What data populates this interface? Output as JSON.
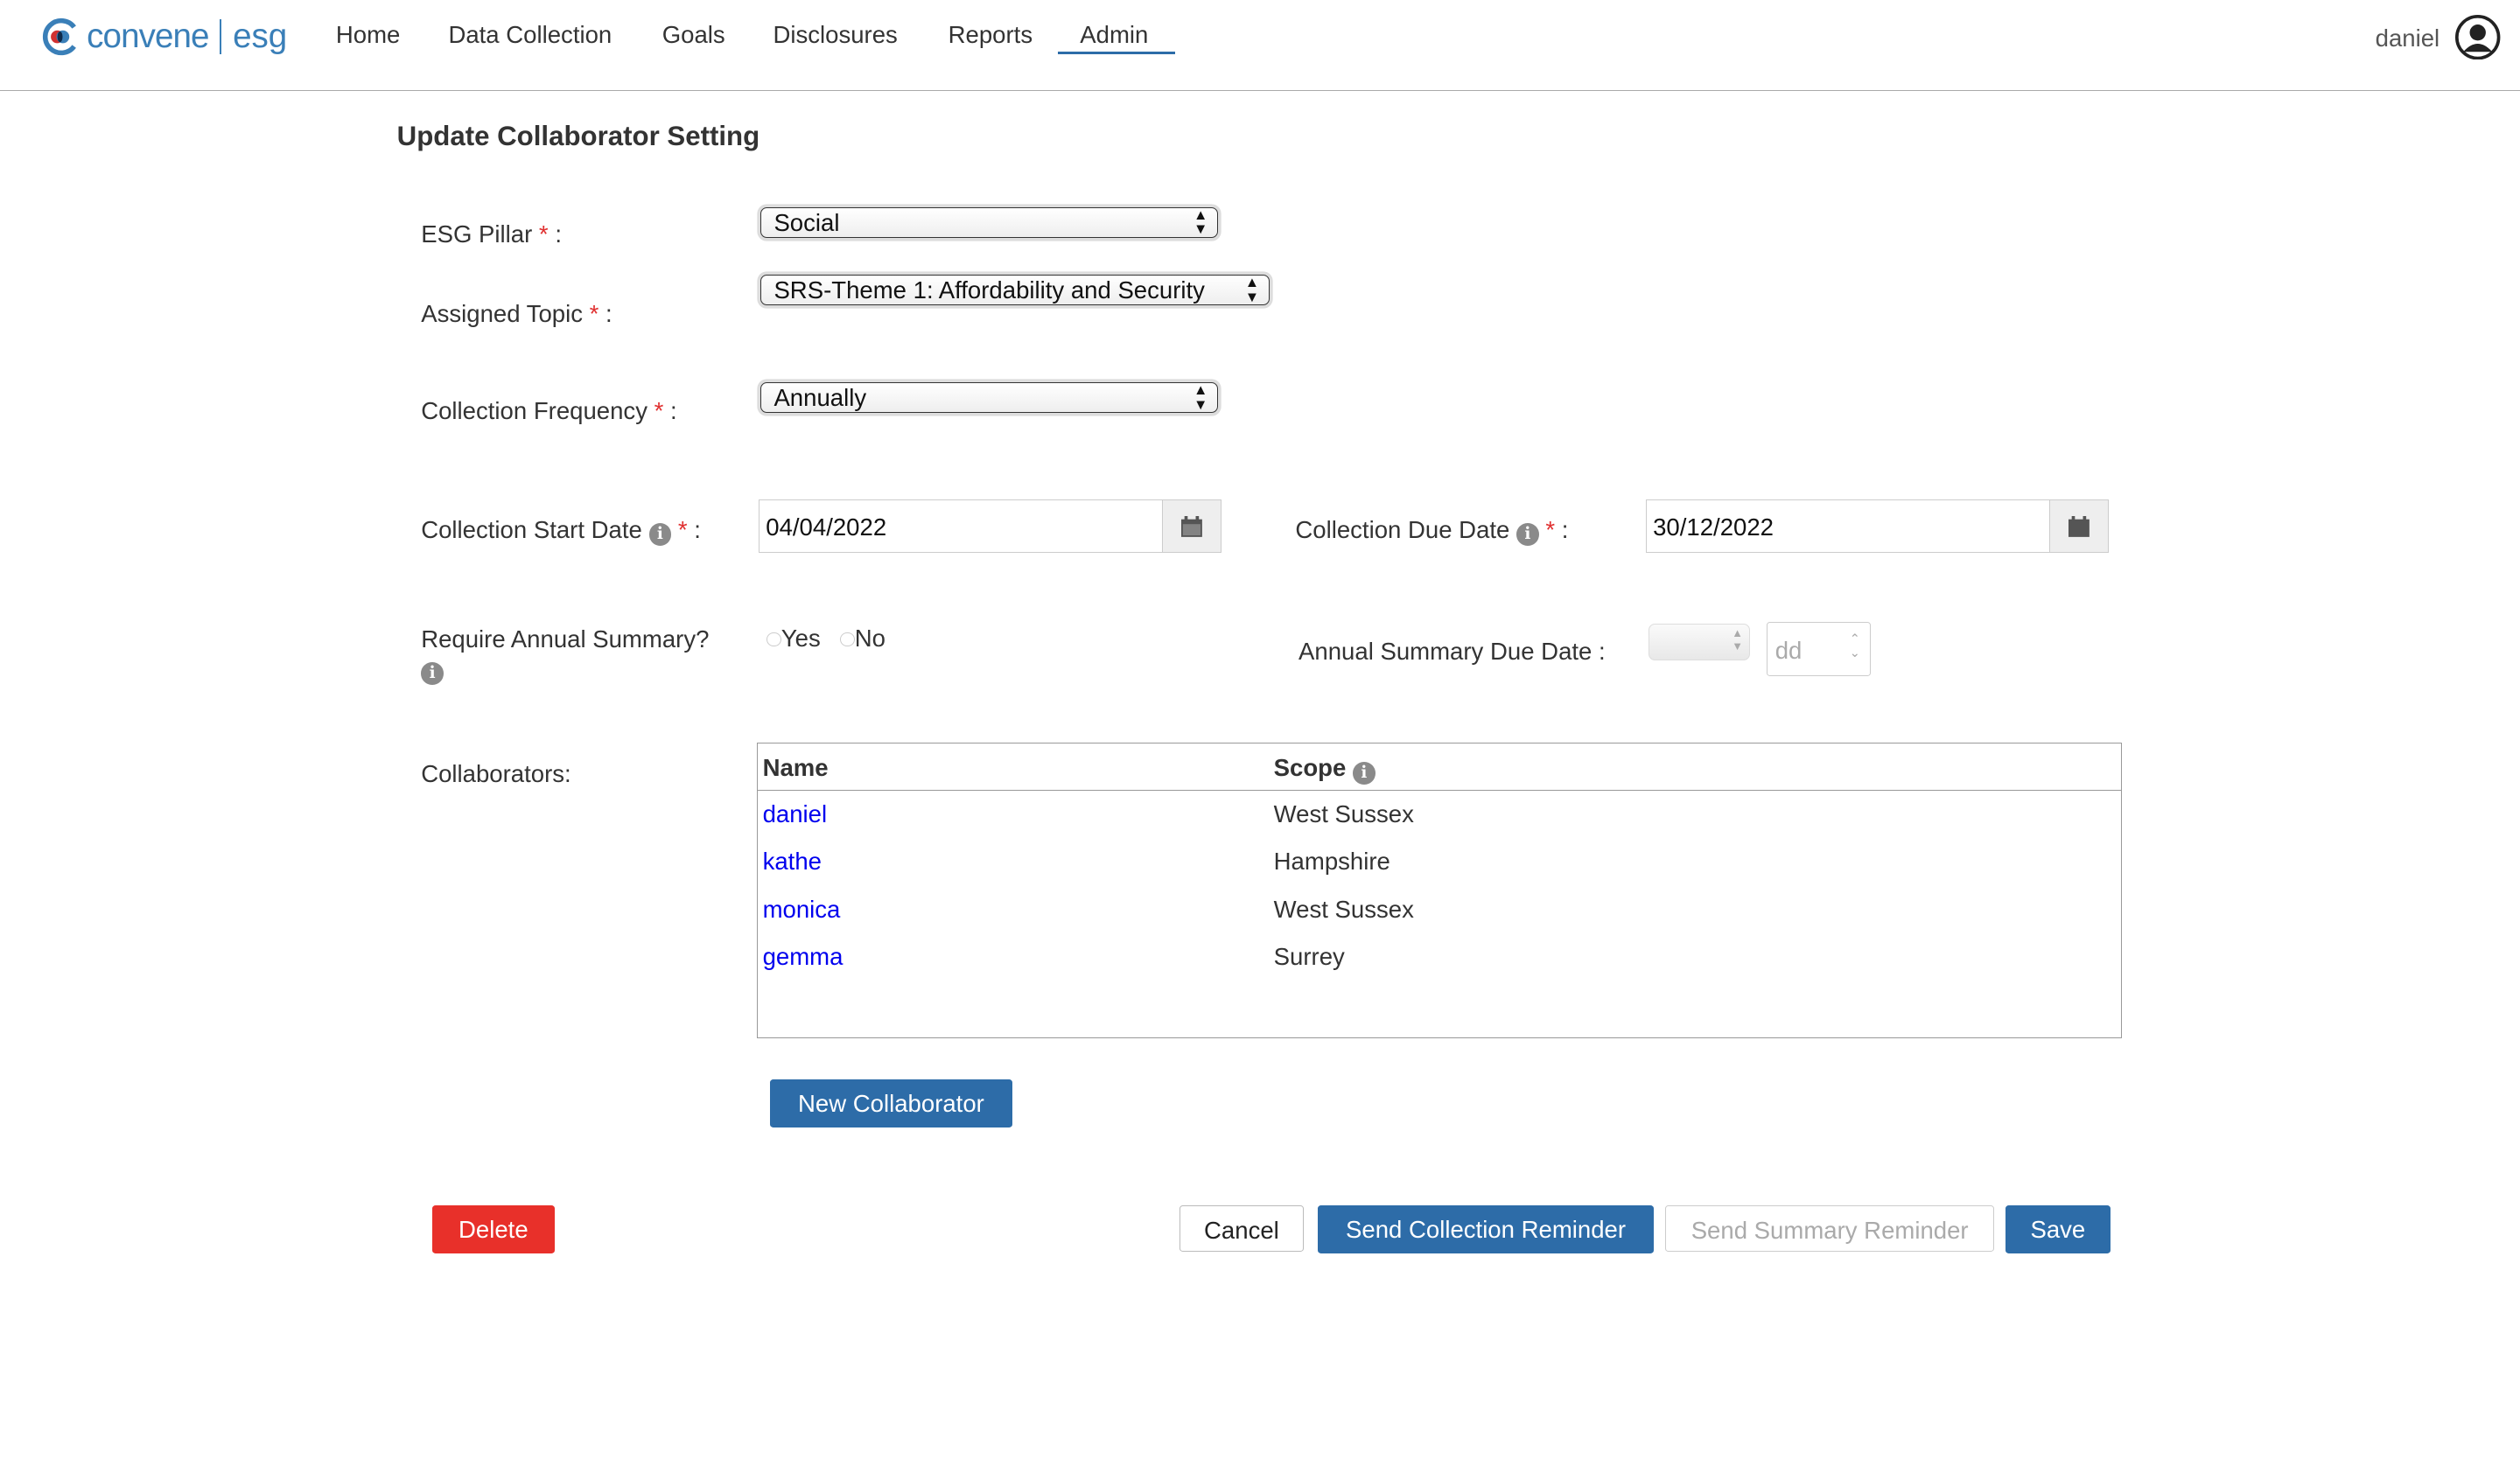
{
  "brand": {
    "name": "convene",
    "product": "esg",
    "colors": {
      "blue": "#3a7fb8",
      "red": "#d03030"
    }
  },
  "nav": {
    "items": [
      "Home",
      "Data Collection",
      "Goals",
      "Disclosures",
      "Reports",
      "Admin"
    ],
    "active": "Admin",
    "user": "daniel"
  },
  "page": {
    "title": "Update Collaborator Setting"
  },
  "form": {
    "esg_pillar": {
      "label": "ESG Pillar",
      "value": "Social"
    },
    "assigned_topic": {
      "label": "Assigned Topic",
      "value": "SRS-Theme 1: Affordability and Security"
    },
    "frequency": {
      "label": "Collection Frequency",
      "value": "Annually"
    },
    "start_date": {
      "label": "Collection Start Date",
      "value": "04/04/2022"
    },
    "due_date": {
      "label": "Collection Due Date",
      "value": "30/12/2022"
    },
    "annual_summary": {
      "label": "Require Annual Summary?",
      "options": [
        "Yes",
        "No"
      ]
    },
    "summary_due": {
      "label": "Annual Summary Due Date :",
      "day_placeholder": "dd"
    },
    "collaborators_label": "Collaborators:"
  },
  "table": {
    "headers": [
      "Name",
      "Scope"
    ],
    "rows": [
      [
        "daniel",
        "West Sussex"
      ],
      [
        "kathe",
        "Hampshire"
      ],
      [
        "monica",
        "West Sussex"
      ],
      [
        "gemma",
        "Surrey"
      ]
    ]
  },
  "buttons": {
    "new_collaborator": "New Collaborator",
    "delete": "Delete",
    "cancel": "Cancel",
    "send_collection": "Send Collection Reminder",
    "send_summary": "Send Summary Reminder",
    "save": "Save"
  },
  "symbols": {
    "req": "*",
    "colon": ":",
    "info": "i"
  }
}
